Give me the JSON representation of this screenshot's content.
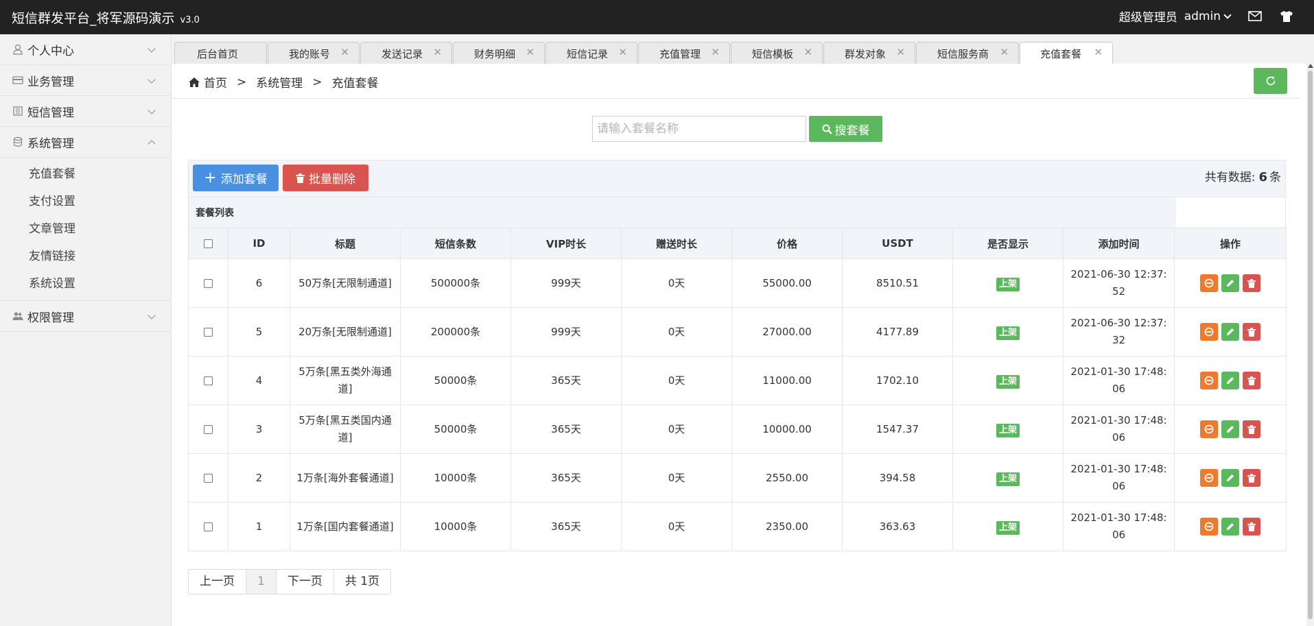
{
  "header": {
    "title": "短信群发平台_将军源码演示",
    "version": "v3.0",
    "role": "超级管理员",
    "username": "admin"
  },
  "sidebar": {
    "items": [
      {
        "label": "个人中心",
        "icon": "user-icon"
      },
      {
        "label": "业务管理",
        "icon": "card-icon"
      },
      {
        "label": "短信管理",
        "icon": "sms-icon"
      },
      {
        "label": "系统管理",
        "icon": "database-icon",
        "expanded": true,
        "children": [
          "充值套餐",
          "支付设置",
          "文章管理",
          "友情链接",
          "系统设置"
        ]
      },
      {
        "label": "权限管理",
        "icon": "users-icon"
      }
    ]
  },
  "tabs": [
    {
      "label": "后台首页",
      "closable": false
    },
    {
      "label": "我的账号",
      "closable": true
    },
    {
      "label": "发送记录",
      "closable": true
    },
    {
      "label": "财务明细",
      "closable": true
    },
    {
      "label": "短信记录",
      "closable": true
    },
    {
      "label": "充值管理",
      "closable": true
    },
    {
      "label": "短信模板",
      "closable": true
    },
    {
      "label": "群发对象",
      "closable": true
    },
    {
      "label": "短信服务商",
      "closable": true
    },
    {
      "label": "充值套餐",
      "closable": true,
      "active": true
    }
  ],
  "breadcrumb": [
    "首页",
    "系统管理",
    "充值套餐"
  ],
  "search": {
    "placeholder": "请输入套餐名称",
    "value": "",
    "button": "搜套餐"
  },
  "actions": {
    "add": "添加套餐",
    "batch_delete": "批量删除"
  },
  "total": {
    "prefix": "共有数据:",
    "count": "6",
    "suffix": "条"
  },
  "table": {
    "caption": "套餐列表",
    "columns": [
      "ID",
      "标题",
      "短信条数",
      "VIP时长",
      "赠送时长",
      "价格",
      "USDT",
      "是否显示",
      "添加时间",
      "操作"
    ],
    "rows": [
      {
        "id": "6",
        "title": "50万条[无限制通道]",
        "count": "500000条",
        "vip": "999天",
        "bonus": "0天",
        "price": "55000.00",
        "usdt": "8510.51",
        "status": "上架",
        "time": "2021-06-30 12:37:52"
      },
      {
        "id": "5",
        "title": "20万条[无限制通道]",
        "count": "200000条",
        "vip": "999天",
        "bonus": "0天",
        "price": "27000.00",
        "usdt": "4177.89",
        "status": "上架",
        "time": "2021-06-30 12:37:32"
      },
      {
        "id": "4",
        "title": "5万条[黑五类外海通道]",
        "count": "50000条",
        "vip": "365天",
        "bonus": "0天",
        "price": "11000.00",
        "usdt": "1702.10",
        "status": "上架",
        "time": "2021-01-30 17:48:06"
      },
      {
        "id": "3",
        "title": "5万条[黑五类国内通道]",
        "count": "50000条",
        "vip": "365天",
        "bonus": "0天",
        "price": "10000.00",
        "usdt": "1547.37",
        "status": "上架",
        "time": "2021-01-30 17:48:06"
      },
      {
        "id": "2",
        "title": "1万条[海外套餐通道]",
        "count": "10000条",
        "vip": "365天",
        "bonus": "0天",
        "price": "2550.00",
        "usdt": "394.58",
        "status": "上架",
        "time": "2021-01-30 17:48:06"
      },
      {
        "id": "1",
        "title": "1万条[国内套餐通道]",
        "count": "10000条",
        "vip": "365天",
        "bonus": "0天",
        "price": "2350.00",
        "usdt": "363.63",
        "status": "上架",
        "time": "2021-01-30 17:48:06"
      }
    ]
  },
  "pager": {
    "prev": "上一页",
    "current": "1",
    "next": "下一页",
    "total": "共 1页"
  },
  "colors": {
    "topbar": "#222222",
    "green": "#5cb85c",
    "blue": "#4a90e2",
    "red": "#d9534f",
    "orange": "#f0792b"
  }
}
